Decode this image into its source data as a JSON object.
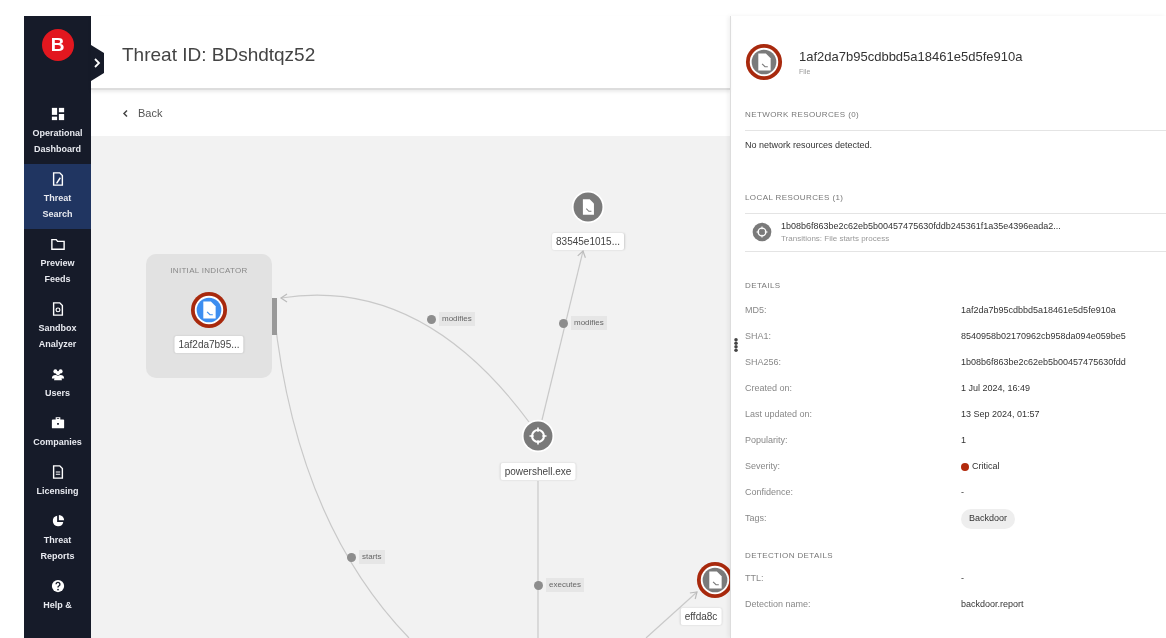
{
  "sidebar": {
    "logo": "B",
    "items": [
      {
        "kind": "dashboard",
        "label": "Operational Dashboard",
        "selected": false
      },
      {
        "kind": "search",
        "label": "Threat Search",
        "selected": true
      },
      {
        "kind": "folder",
        "label": "Preview Feeds",
        "selected": false
      },
      {
        "kind": "sandbox",
        "label": "Sandbox Analyzer",
        "selected": false
      },
      {
        "kind": "users",
        "label": "Users",
        "selected": false
      },
      {
        "kind": "companies",
        "label": "Companies",
        "selected": false
      },
      {
        "kind": "licensing",
        "label": "Licensing",
        "selected": false
      },
      {
        "kind": "reports",
        "label": "Threat Reports",
        "selected": false
      },
      {
        "kind": "help",
        "label": "Help &",
        "selected": false
      }
    ]
  },
  "header": {
    "title": "Threat ID: BDshdtqz52",
    "back": "Back"
  },
  "graph": {
    "initial_caption": "INITIAL INDICATOR",
    "nodes": [
      {
        "kind": "file",
        "label": "1af2da7b95...",
        "flagged": true,
        "selected": true
      },
      {
        "kind": "file",
        "label": "83545e1015...",
        "flagged": false,
        "selected": false
      },
      {
        "kind": "process",
        "label": "powershell.exe",
        "flagged": false,
        "selected": false
      },
      {
        "kind": "file",
        "label": "effda8c",
        "flagged": true,
        "selected": false
      }
    ],
    "edges": [
      {
        "label": "modifies"
      },
      {
        "label": "modifies"
      },
      {
        "label": "starts"
      },
      {
        "label": "executes"
      }
    ]
  },
  "panel": {
    "title": "1af2da7b95cdbbd5a18461e5d5fe910a",
    "subtitle": "File",
    "flagged": true,
    "network_heading": "NETWORK RESOURCES (0)",
    "network_empty": "No network resources detected.",
    "local_heading": "LOCAL RESOURCES (1)",
    "local_resources": [
      {
        "kind": "process",
        "name": "1b08b6f863be2c62eb5b00457475630fddb245361f1a35e4396eada2...",
        "detail": "Transitions: File starts process"
      }
    ],
    "details_heading": "DETAILS",
    "details": [
      {
        "kind": "text",
        "label": "MD5:",
        "value": "1af2da7b95cdbbd5a18461e5d5fe910a"
      },
      {
        "kind": "text",
        "label": "SHA1:",
        "value": "8540958b02170962cb958da094e059be5"
      },
      {
        "kind": "text",
        "label": "SHA256:",
        "value": "1b08b6f863be2c62eb5b00457475630fdd"
      },
      {
        "kind": "text",
        "label": "Created on:",
        "value": "1 Jul 2024, 16:49"
      },
      {
        "kind": "text",
        "label": "Last updated on:",
        "value": "13 Sep 2024, 01:57"
      },
      {
        "kind": "text",
        "label": "Popularity:",
        "value": "1"
      },
      {
        "kind": "severity",
        "label": "Severity:",
        "value": "Critical",
        "color": "#b22a0c"
      },
      {
        "kind": "text",
        "label": "Confidence:",
        "value": "-"
      },
      {
        "kind": "tag",
        "label": "Tags:",
        "value": "Backdoor"
      }
    ],
    "detection_heading": "DETECTION DETAILS",
    "detection": [
      {
        "kind": "text",
        "label": "TTL:",
        "value": "-"
      },
      {
        "kind": "text",
        "label": "Detection name:",
        "value": "backdoor.report"
      }
    ]
  }
}
